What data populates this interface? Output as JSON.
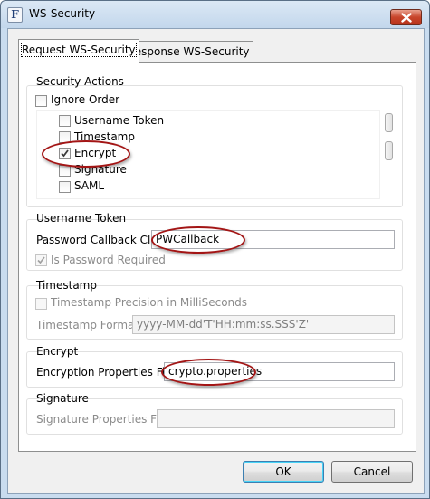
{
  "window": {
    "title": "WS-Security",
    "app_icon_glyph": "F"
  },
  "tabs": [
    {
      "label": "Request WS-Security",
      "active": true
    },
    {
      "label": "Response WS-Security",
      "active": false
    }
  ],
  "security_actions": {
    "heading": "Security Actions",
    "ignore_order": {
      "label": "Ignore Order",
      "checked": false
    },
    "items": [
      {
        "label": "Username Token",
        "checked": false
      },
      {
        "label": "Timestamp",
        "checked": false
      },
      {
        "label": "Encrypt",
        "checked": true
      },
      {
        "label": "Signature",
        "checked": false
      },
      {
        "label": "SAML",
        "checked": false
      }
    ]
  },
  "username_token": {
    "heading": "Username Token",
    "callback_label": "Password Callback Class",
    "callback_value": "PWCallback",
    "password_required_label": "Is Password Required",
    "password_required_checked": true
  },
  "timestamp": {
    "heading": "Timestamp",
    "precision_label": "Timestamp Precision in MilliSeconds",
    "precision_checked": false,
    "format_label": "Timestamp Format",
    "format_value": "yyyy-MM-dd'T'HH:mm:ss.SSS'Z'"
  },
  "encrypt": {
    "heading": "Encrypt",
    "properties_label": "Encryption Properties File",
    "properties_value": "crypto.properties"
  },
  "signature": {
    "heading": "Signature",
    "properties_label": "Signature Properties File",
    "properties_value": ""
  },
  "buttons": {
    "ok": "OK",
    "cancel": "Cancel"
  },
  "colors": {
    "highlight_ring": "#a31515",
    "default_button_border": "#3c7fb1"
  }
}
